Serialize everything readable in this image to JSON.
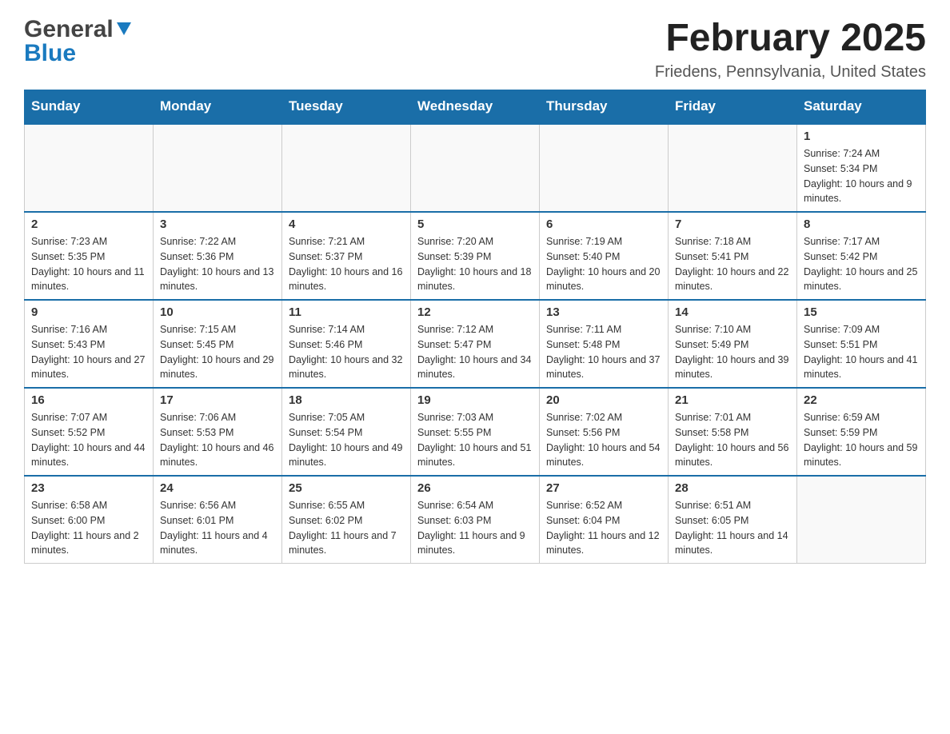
{
  "header": {
    "logo_general": "General",
    "logo_blue": "Blue",
    "month_title": "February 2025",
    "location": "Friedens, Pennsylvania, United States"
  },
  "calendar": {
    "days_of_week": [
      "Sunday",
      "Monday",
      "Tuesday",
      "Wednesday",
      "Thursday",
      "Friday",
      "Saturday"
    ],
    "weeks": [
      [
        {
          "day": "",
          "info": ""
        },
        {
          "day": "",
          "info": ""
        },
        {
          "day": "",
          "info": ""
        },
        {
          "day": "",
          "info": ""
        },
        {
          "day": "",
          "info": ""
        },
        {
          "day": "",
          "info": ""
        },
        {
          "day": "1",
          "info": "Sunrise: 7:24 AM\nSunset: 5:34 PM\nDaylight: 10 hours and 9 minutes."
        }
      ],
      [
        {
          "day": "2",
          "info": "Sunrise: 7:23 AM\nSunset: 5:35 PM\nDaylight: 10 hours and 11 minutes."
        },
        {
          "day": "3",
          "info": "Sunrise: 7:22 AM\nSunset: 5:36 PM\nDaylight: 10 hours and 13 minutes."
        },
        {
          "day": "4",
          "info": "Sunrise: 7:21 AM\nSunset: 5:37 PM\nDaylight: 10 hours and 16 minutes."
        },
        {
          "day": "5",
          "info": "Sunrise: 7:20 AM\nSunset: 5:39 PM\nDaylight: 10 hours and 18 minutes."
        },
        {
          "day": "6",
          "info": "Sunrise: 7:19 AM\nSunset: 5:40 PM\nDaylight: 10 hours and 20 minutes."
        },
        {
          "day": "7",
          "info": "Sunrise: 7:18 AM\nSunset: 5:41 PM\nDaylight: 10 hours and 22 minutes."
        },
        {
          "day": "8",
          "info": "Sunrise: 7:17 AM\nSunset: 5:42 PM\nDaylight: 10 hours and 25 minutes."
        }
      ],
      [
        {
          "day": "9",
          "info": "Sunrise: 7:16 AM\nSunset: 5:43 PM\nDaylight: 10 hours and 27 minutes."
        },
        {
          "day": "10",
          "info": "Sunrise: 7:15 AM\nSunset: 5:45 PM\nDaylight: 10 hours and 29 minutes."
        },
        {
          "day": "11",
          "info": "Sunrise: 7:14 AM\nSunset: 5:46 PM\nDaylight: 10 hours and 32 minutes."
        },
        {
          "day": "12",
          "info": "Sunrise: 7:12 AM\nSunset: 5:47 PM\nDaylight: 10 hours and 34 minutes."
        },
        {
          "day": "13",
          "info": "Sunrise: 7:11 AM\nSunset: 5:48 PM\nDaylight: 10 hours and 37 minutes."
        },
        {
          "day": "14",
          "info": "Sunrise: 7:10 AM\nSunset: 5:49 PM\nDaylight: 10 hours and 39 minutes."
        },
        {
          "day": "15",
          "info": "Sunrise: 7:09 AM\nSunset: 5:51 PM\nDaylight: 10 hours and 41 minutes."
        }
      ],
      [
        {
          "day": "16",
          "info": "Sunrise: 7:07 AM\nSunset: 5:52 PM\nDaylight: 10 hours and 44 minutes."
        },
        {
          "day": "17",
          "info": "Sunrise: 7:06 AM\nSunset: 5:53 PM\nDaylight: 10 hours and 46 minutes."
        },
        {
          "day": "18",
          "info": "Sunrise: 7:05 AM\nSunset: 5:54 PM\nDaylight: 10 hours and 49 minutes."
        },
        {
          "day": "19",
          "info": "Sunrise: 7:03 AM\nSunset: 5:55 PM\nDaylight: 10 hours and 51 minutes."
        },
        {
          "day": "20",
          "info": "Sunrise: 7:02 AM\nSunset: 5:56 PM\nDaylight: 10 hours and 54 minutes."
        },
        {
          "day": "21",
          "info": "Sunrise: 7:01 AM\nSunset: 5:58 PM\nDaylight: 10 hours and 56 minutes."
        },
        {
          "day": "22",
          "info": "Sunrise: 6:59 AM\nSunset: 5:59 PM\nDaylight: 10 hours and 59 minutes."
        }
      ],
      [
        {
          "day": "23",
          "info": "Sunrise: 6:58 AM\nSunset: 6:00 PM\nDaylight: 11 hours and 2 minutes."
        },
        {
          "day": "24",
          "info": "Sunrise: 6:56 AM\nSunset: 6:01 PM\nDaylight: 11 hours and 4 minutes."
        },
        {
          "day": "25",
          "info": "Sunrise: 6:55 AM\nSunset: 6:02 PM\nDaylight: 11 hours and 7 minutes."
        },
        {
          "day": "26",
          "info": "Sunrise: 6:54 AM\nSunset: 6:03 PM\nDaylight: 11 hours and 9 minutes."
        },
        {
          "day": "27",
          "info": "Sunrise: 6:52 AM\nSunset: 6:04 PM\nDaylight: 11 hours and 12 minutes."
        },
        {
          "day": "28",
          "info": "Sunrise: 6:51 AM\nSunset: 6:05 PM\nDaylight: 11 hours and 14 minutes."
        },
        {
          "day": "",
          "info": ""
        }
      ]
    ]
  }
}
